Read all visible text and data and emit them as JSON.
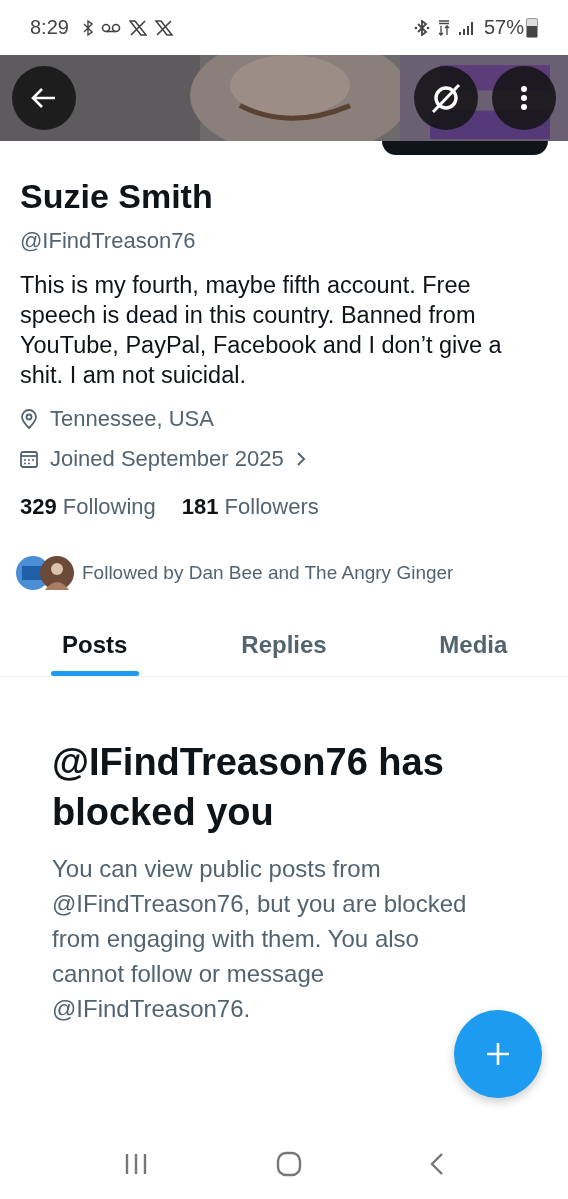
{
  "status_bar": {
    "time": "8:29",
    "battery": "57%"
  },
  "profile": {
    "name": "Suzie Smith",
    "handle": "@IFindTreason76",
    "bio": "This is my fourth, maybe fifth account. Free speech is dead in this country. Banned from YouTube, PayPal, Facebook and I don’t give a shit.   I am not suicidal.",
    "location": "Tennessee, USA",
    "joined": "Joined September 2025",
    "following_count": "329",
    "following_label": "Following",
    "followers_count": "181",
    "followers_label": "Followers",
    "followed_by": "Followed by Dan Bee and The Angry Ginger"
  },
  "tabs": [
    {
      "label": "Posts",
      "selected": true
    },
    {
      "label": "Replies",
      "selected": false
    },
    {
      "label": "Media",
      "selected": false
    }
  ],
  "blocked": {
    "title": "@IFindTreason76 has blocked you",
    "message": "You can view public posts from @IFindTreason76, but you are blocked from engaging with them. You also cannot follow or message @IFindTreason76."
  }
}
